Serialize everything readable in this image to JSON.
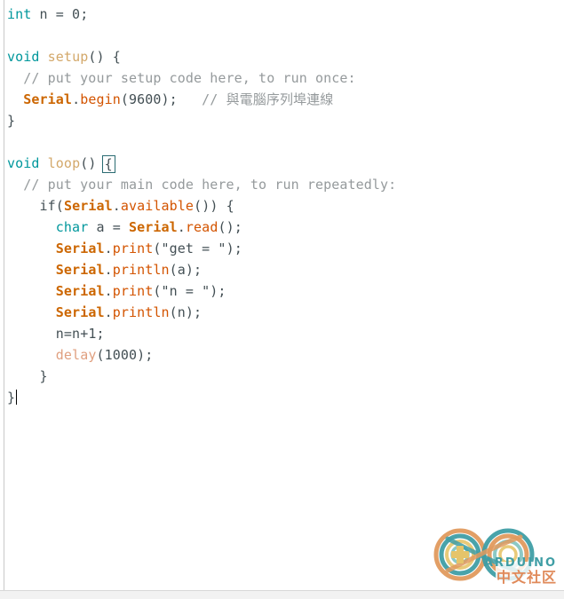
{
  "app": {
    "name": "Arduino IDE Code Editor",
    "background_color": "#ffffff"
  },
  "colors": {
    "keyword": "#00979c",
    "function_name": "#d3a86a",
    "comment": "#959a9c",
    "object": "#cc6600",
    "method": "#d35400",
    "builtin": "#e0a080",
    "plain_text": "#434f54",
    "brace_match_outline": "#2a6b72",
    "bottom_band": "#f2f2f2",
    "gutter_divider": "#c9c9c9"
  },
  "code": {
    "lines": [
      {
        "n": 1,
        "indent": "",
        "tokens": [
          {
            "t": "int",
            "c": "keyword"
          },
          {
            "t": " n = 0;",
            "c": "plain"
          }
        ]
      },
      {
        "n": 2,
        "indent": "",
        "tokens": []
      },
      {
        "n": 3,
        "indent": "",
        "tokens": [
          {
            "t": "void",
            "c": "keyword"
          },
          {
            "t": " ",
            "c": "plain"
          },
          {
            "t": "setup",
            "c": "funcname"
          },
          {
            "t": "() {",
            "c": "plain"
          }
        ]
      },
      {
        "n": 4,
        "indent": "  ",
        "tokens": [
          {
            "t": "// put your setup code here, to run once:",
            "c": "comment"
          }
        ]
      },
      {
        "n": 5,
        "indent": "  ",
        "tokens": [
          {
            "t": "Serial",
            "c": "object"
          },
          {
            "t": ".",
            "c": "plain"
          },
          {
            "t": "begin",
            "c": "method"
          },
          {
            "t": "(9600);",
            "c": "plain"
          },
          {
            "t": "   // 與電腦序列埠連線",
            "c": "comment"
          }
        ]
      },
      {
        "n": 6,
        "indent": "",
        "tokens": [
          {
            "t": "}",
            "c": "plain"
          }
        ]
      },
      {
        "n": 7,
        "indent": "",
        "tokens": []
      },
      {
        "n": 8,
        "indent": "",
        "tokens": [
          {
            "t": "void",
            "c": "keyword"
          },
          {
            "t": " ",
            "c": "plain"
          },
          {
            "t": "loop",
            "c": "funcname"
          },
          {
            "t": "() ",
            "c": "plain"
          },
          {
            "t": "{",
            "c": "brace-match"
          }
        ]
      },
      {
        "n": 9,
        "indent": "  ",
        "tokens": [
          {
            "t": "// put your main code here, to run repeatedly:",
            "c": "comment"
          }
        ]
      },
      {
        "n": 10,
        "indent": "    ",
        "tokens": [
          {
            "t": "if(",
            "c": "plain"
          },
          {
            "t": "Serial",
            "c": "object"
          },
          {
            "t": ".",
            "c": "plain"
          },
          {
            "t": "available",
            "c": "method"
          },
          {
            "t": "()) {",
            "c": "plain"
          }
        ]
      },
      {
        "n": 11,
        "indent": "      ",
        "tokens": [
          {
            "t": "char",
            "c": "keyword"
          },
          {
            "t": " a = ",
            "c": "plain"
          },
          {
            "t": "Serial",
            "c": "object"
          },
          {
            "t": ".",
            "c": "plain"
          },
          {
            "t": "read",
            "c": "method"
          },
          {
            "t": "();",
            "c": "plain"
          }
        ]
      },
      {
        "n": 12,
        "indent": "      ",
        "tokens": [
          {
            "t": "Serial",
            "c": "object"
          },
          {
            "t": ".",
            "c": "plain"
          },
          {
            "t": "print",
            "c": "method"
          },
          {
            "t": "(\"get = \");",
            "c": "plain"
          }
        ]
      },
      {
        "n": 13,
        "indent": "      ",
        "tokens": [
          {
            "t": "Serial",
            "c": "object"
          },
          {
            "t": ".",
            "c": "plain"
          },
          {
            "t": "println",
            "c": "method"
          },
          {
            "t": "(a);",
            "c": "plain"
          }
        ]
      },
      {
        "n": 14,
        "indent": "      ",
        "tokens": [
          {
            "t": "Serial",
            "c": "object"
          },
          {
            "t": ".",
            "c": "plain"
          },
          {
            "t": "print",
            "c": "method"
          },
          {
            "t": "(\"n = \");",
            "c": "plain"
          }
        ]
      },
      {
        "n": 15,
        "indent": "      ",
        "tokens": [
          {
            "t": "Serial",
            "c": "object"
          },
          {
            "t": ".",
            "c": "plain"
          },
          {
            "t": "println",
            "c": "method"
          },
          {
            "t": "(n);",
            "c": "plain"
          }
        ]
      },
      {
        "n": 16,
        "indent": "      ",
        "tokens": [
          {
            "t": "n=n+1;",
            "c": "plain"
          }
        ]
      },
      {
        "n": 17,
        "indent": "      ",
        "tokens": [
          {
            "t": "delay",
            "c": "builtin"
          },
          {
            "t": "(1000);",
            "c": "plain"
          }
        ]
      },
      {
        "n": 18,
        "indent": "    ",
        "tokens": [
          {
            "t": "}",
            "c": "plain"
          }
        ]
      },
      {
        "n": 19,
        "indent": "",
        "tokens": [
          {
            "t": "}",
            "c": "plain"
          },
          {
            "t": "",
            "c": "caret"
          }
        ]
      }
    ]
  },
  "watermark": {
    "brand": "ARDUINO",
    "community": "中文社区",
    "brand_color": "#3f9ea5",
    "community_color": "#e08a5a"
  }
}
